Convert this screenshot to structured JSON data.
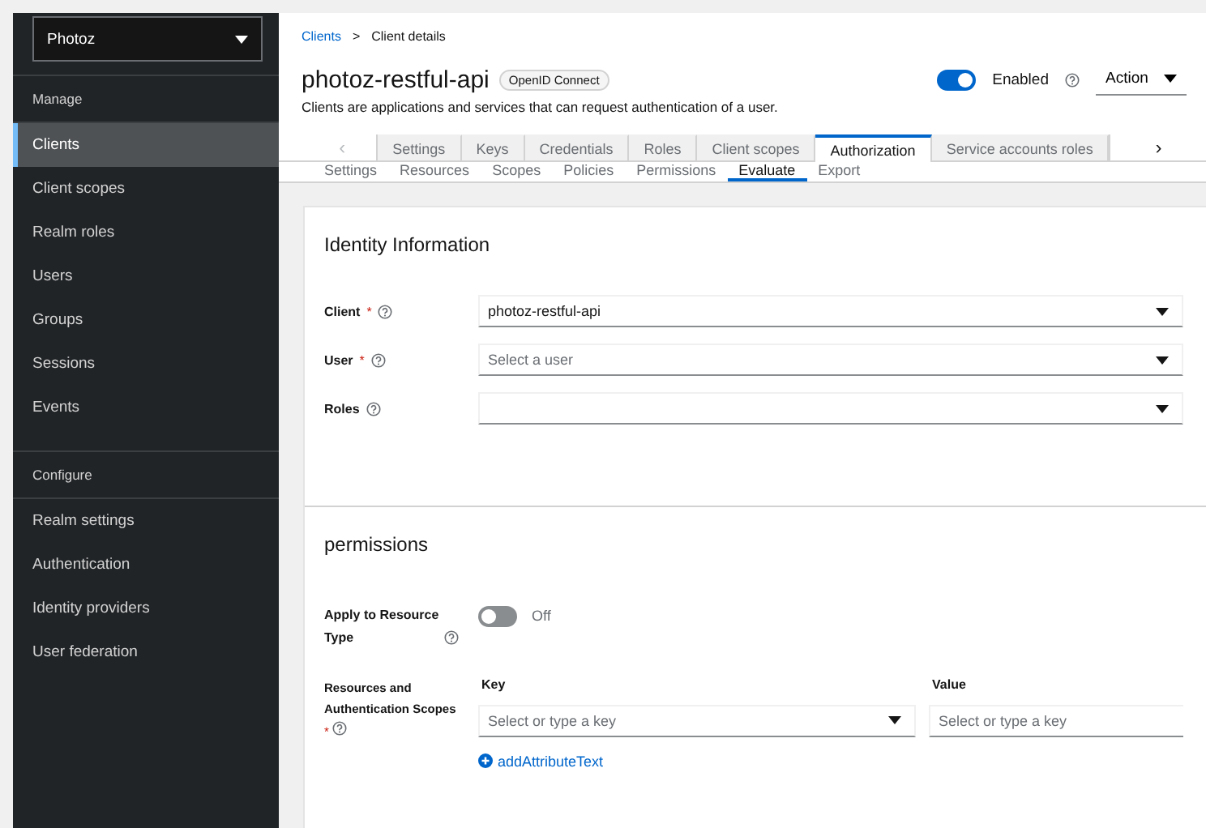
{
  "sidebar": {
    "realm_selector": "Photoz",
    "groups": [
      {
        "heading": "Manage",
        "items": [
          {
            "label": "Clients",
            "selected": true
          },
          {
            "label": "Client scopes",
            "selected": false
          },
          {
            "label": "Realm roles",
            "selected": false
          },
          {
            "label": "Users",
            "selected": false
          },
          {
            "label": "Groups",
            "selected": false
          },
          {
            "label": "Sessions",
            "selected": false
          },
          {
            "label": "Events",
            "selected": false
          }
        ]
      },
      {
        "heading": "Configure",
        "items": [
          {
            "label": "Realm settings",
            "selected": false
          },
          {
            "label": "Authentication",
            "selected": false
          },
          {
            "label": "Identity providers",
            "selected": false
          },
          {
            "label": "User federation",
            "selected": false
          }
        ]
      }
    ]
  },
  "breadcrumb": {
    "link": "Clients",
    "separator": ">",
    "current": "Client details"
  },
  "header": {
    "title": "photoz-restful-api",
    "badge": "OpenID Connect",
    "description": "Clients are applications and services that can request authentication of a user.",
    "enabled_toggle": {
      "label": "Enabled",
      "on": true
    },
    "action_menu": "Action"
  },
  "tabs": {
    "scroll_left": "‹",
    "scroll_right": "›",
    "items": [
      {
        "label": "Settings",
        "selected": false
      },
      {
        "label": "Keys",
        "selected": false
      },
      {
        "label": "Credentials",
        "selected": false
      },
      {
        "label": "Roles",
        "selected": false
      },
      {
        "label": "Client scopes",
        "selected": false
      },
      {
        "label": "Authorization",
        "selected": true
      },
      {
        "label": "Service accounts roles",
        "selected": false
      }
    ]
  },
  "subtabs": [
    {
      "label": "Settings",
      "selected": false
    },
    {
      "label": "Resources",
      "selected": false
    },
    {
      "label": "Scopes",
      "selected": false
    },
    {
      "label": "Policies",
      "selected": false
    },
    {
      "label": "Permissions",
      "selected": false
    },
    {
      "label": "Evaluate",
      "selected": true
    },
    {
      "label": "Export",
      "selected": false
    }
  ],
  "identity_information": {
    "title": "Identity Information",
    "fields": [
      {
        "label": "Client",
        "required_mark": "*",
        "value": "photoz-restful-api"
      },
      {
        "label": "User",
        "required_mark": "*",
        "placeholder": "Select a user"
      },
      {
        "label": "Roles"
      }
    ]
  },
  "permissions": {
    "title": "permissions",
    "apply_to_resource_type": {
      "label": "Apply to Resource Type",
      "on": false,
      "state_text": "Off"
    },
    "resources_and_scopes": {
      "label": "Resources and Authentication Scopes",
      "required_mark": "*",
      "key_header": "Key",
      "value_header": "Value",
      "key_placeholder": "Select or type a key",
      "value_placeholder": "Select or type a key",
      "add_link": "addAttributeText"
    }
  }
}
